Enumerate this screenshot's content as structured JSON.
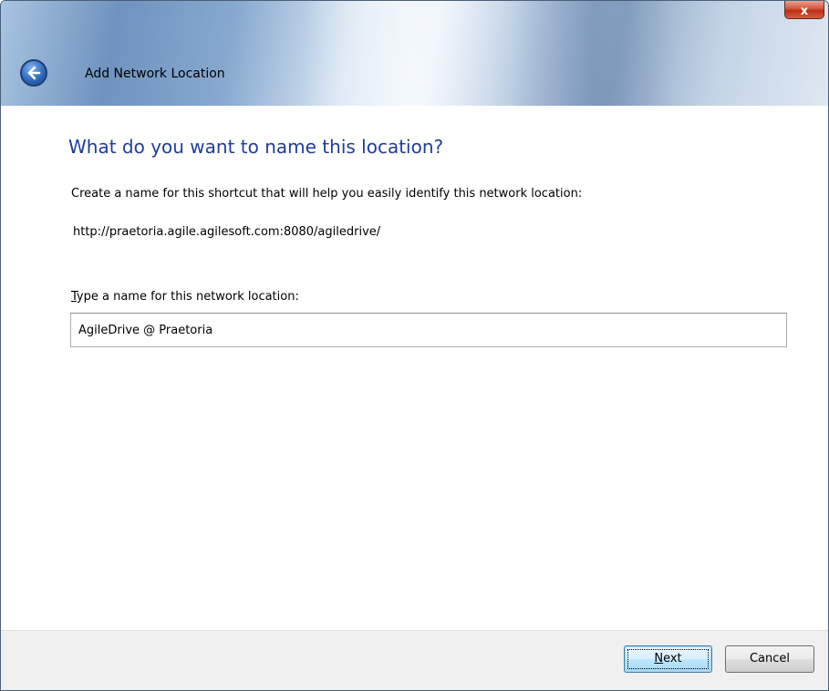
{
  "window": {
    "title": "Add Network Location",
    "close_symbol": "x",
    "back_icon": "back-arrow-icon"
  },
  "main": {
    "heading": "What do you want to name this location?",
    "description": "Create a name for this shortcut that will help you easily identify this network location:",
    "url": "http://praetoria.agile.agilesoft.com:8080/agiledrive/",
    "field_label_first": "T",
    "field_label_rest": "ype a name for this network location:",
    "name_value": "AgileDrive @ Praetoria"
  },
  "footer": {
    "next_mnemonic": "N",
    "next_rest": "ext",
    "cancel_label": "Cancel"
  },
  "colors": {
    "heading": "#1e3d9b",
    "close_button": "#c9462a",
    "back_button": "#2f6cc0"
  }
}
